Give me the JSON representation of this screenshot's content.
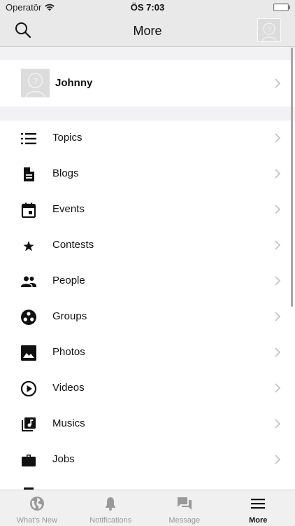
{
  "status": {
    "carrier": "Operatör",
    "time": "ÖS 7:03"
  },
  "navbar": {
    "title": "More"
  },
  "profile": {
    "name": "Johnny"
  },
  "menu": [
    {
      "label": "Topics",
      "icon": "list-icon"
    },
    {
      "label": "Blogs",
      "icon": "document-icon"
    },
    {
      "label": "Events",
      "icon": "calendar-icon"
    },
    {
      "label": "Contests",
      "icon": "star-icon"
    },
    {
      "label": "People",
      "icon": "people-icon"
    },
    {
      "label": "Groups",
      "icon": "groups-icon"
    },
    {
      "label": "Photos",
      "icon": "photo-icon"
    },
    {
      "label": "Videos",
      "icon": "play-circle-icon"
    },
    {
      "label": "Musics",
      "icon": "music-library-icon"
    },
    {
      "label": "Jobs",
      "icon": "briefcase-icon"
    }
  ],
  "tabs": [
    {
      "label": "What's New",
      "icon": "globe-icon"
    },
    {
      "label": "Notifications",
      "icon": "bell-icon"
    },
    {
      "label": "Message",
      "icon": "chat-icon"
    },
    {
      "label": "More",
      "icon": "menu-icon"
    }
  ],
  "colors": {
    "bar_background": "#e9e9e9",
    "section_background": "#f2f2f4",
    "inactive_tab": "#999999",
    "active_tab": "#111111"
  }
}
